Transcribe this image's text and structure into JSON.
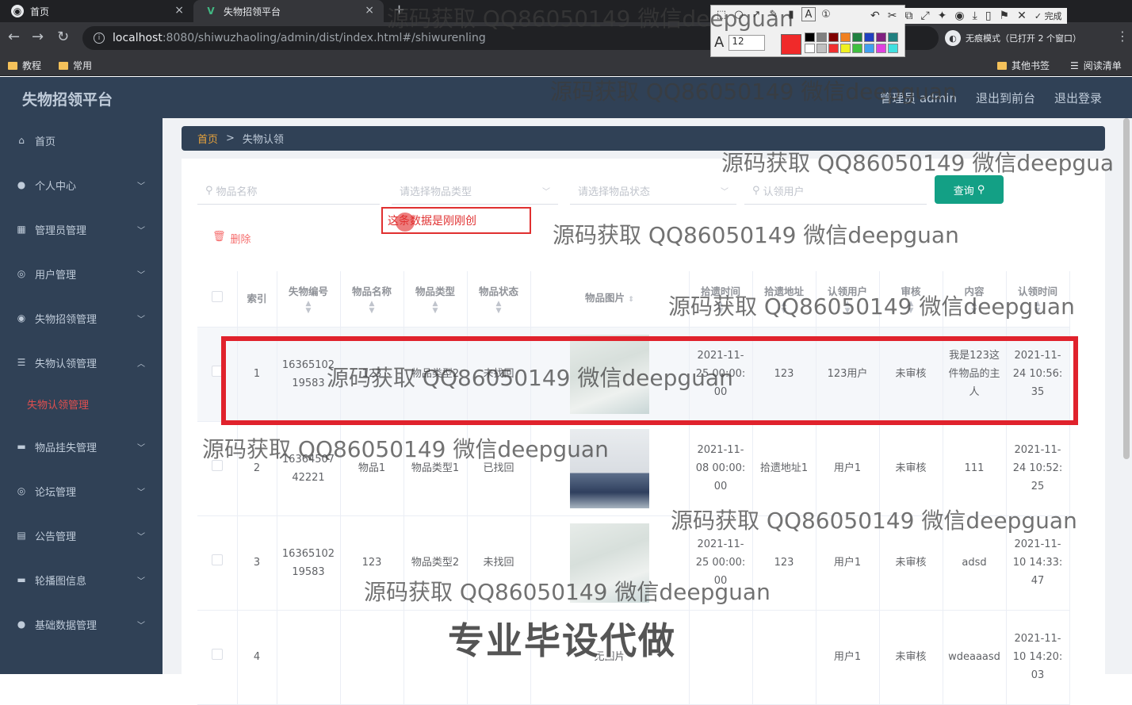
{
  "browser": {
    "tabs": [
      {
        "label": "首页",
        "close": "×"
      },
      {
        "label": "失物招领平台",
        "close": "×"
      }
    ],
    "new_tab": "+",
    "url_host": "localhost",
    "url_path": ":8080/shiwuzhaoling/admin/dist/index.html#/shiwurenling",
    "incognito_label": "无痕模式（已打开 2 个窗口）",
    "bookmarks": [
      {
        "label": "教程"
      },
      {
        "label": "常用"
      },
      {
        "label": "其他书签"
      },
      {
        "label": "阅读清单"
      }
    ],
    "done_label": "完成",
    "font_size": "12"
  },
  "app": {
    "logo": "失物招领平台",
    "header_links": [
      "管理员 admin",
      "退出到前台",
      "退出登录"
    ],
    "breadcrumb": {
      "home": "首页",
      "sep": ">",
      "current": "失物认领"
    }
  },
  "sidebar": {
    "items": [
      {
        "label": "首页",
        "icon": "home-icon"
      },
      {
        "label": "个人中心",
        "icon": "user-icon"
      },
      {
        "label": "管理员管理",
        "icon": "grid-icon"
      },
      {
        "label": "用户管理",
        "icon": "compass-icon"
      },
      {
        "label": "失物招领管理",
        "icon": "target-icon"
      },
      {
        "label": "失物认领管理",
        "icon": "list-icon"
      },
      {
        "label": "失物认领管理",
        "icon": ""
      },
      {
        "label": "物品挂失管理",
        "icon": "monitor-icon"
      },
      {
        "label": "论坛管理",
        "icon": "compass-icon"
      },
      {
        "label": "公告管理",
        "icon": "clipboard-icon"
      },
      {
        "label": "轮播图信息",
        "icon": "monitor-icon"
      },
      {
        "label": "基础数据管理",
        "icon": "user-icon"
      }
    ]
  },
  "filters": {
    "name_placeholder": "物品名称",
    "type_placeholder": "请选择物品类型",
    "status_placeholder": "请选择物品状态",
    "user_placeholder": "认领用户",
    "query_label": "查询",
    "delete_label": "删除"
  },
  "popup_text": "这条数据是刚刚创",
  "table": {
    "headers": [
      "索引",
      "失物编号",
      "物品名称",
      "物品类型",
      "物品状态",
      "物品图片",
      "拾遗时间",
      "拾遗地址",
      "认领用户",
      "审核",
      "内容",
      "认领时间"
    ],
    "rows": [
      {
        "index": "1",
        "code": "1636510219583",
        "name": "123",
        "type": "物品类型2",
        "status": "未找回",
        "time": "2021-11-25 00:00:00",
        "addr": "123",
        "user": "123用户",
        "audit": "未审核",
        "content": "我是123这件物品的主人",
        "claim": "2021-11-24 10:56:35",
        "img": "light"
      },
      {
        "index": "2",
        "code": "1636450742221",
        "name": "物品1",
        "type": "物品类型1",
        "status": "已找回",
        "time": "2021-11-08 00:00:00",
        "addr": "拾遗地址1",
        "user": "用户1",
        "audit": "未审核",
        "content": "111",
        "claim": "2021-11-24 10:52:25",
        "img": "vases"
      },
      {
        "index": "3",
        "code": "1636510219583",
        "name": "123",
        "type": "物品类型2",
        "status": "未找回",
        "time": "2021-11-25 00:00:00",
        "addr": "123",
        "user": "用户1",
        "audit": "未审核",
        "content": "adsd",
        "claim": "2021-11-10 14:33:47",
        "img": "light"
      },
      {
        "index": "4",
        "code": "",
        "name": "",
        "type": "",
        "status": "",
        "time": "",
        "addr": "",
        "user": "用户1",
        "audit": "未审核",
        "content": "wdeaaasd",
        "claim": "2021-11-10 14:20:03",
        "img": "none",
        "img_alt": "无图片"
      }
    ]
  },
  "watermarks": {
    "text": "源码获取 QQ86050149 微信deepguan",
    "text_cut": "源码获取 QQ86050149 微信deepgua",
    "big": "专业毕设代做"
  }
}
